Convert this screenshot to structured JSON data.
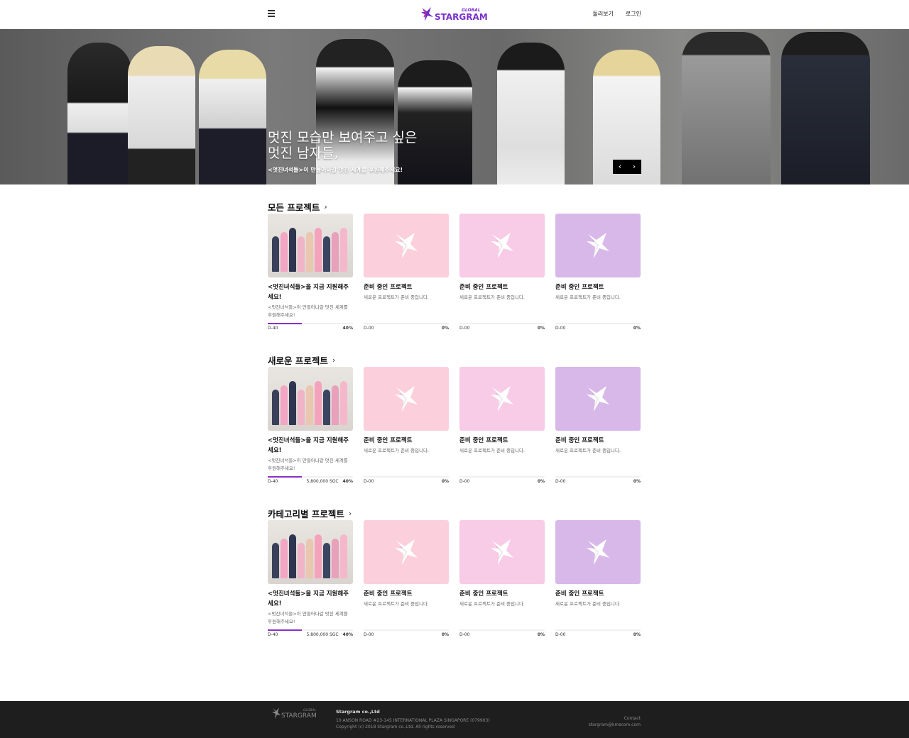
{
  "header": {
    "logo_small": "GLOBAL",
    "logo_main": "STARGRAM",
    "nav": [
      "둘러보기",
      "로그인"
    ]
  },
  "hero": {
    "title_line1": "멋진 모습만 보여주고 싶은",
    "title_line2": "멋진 남자들,",
    "subtitle": "<멋진녀석들>이 만들어나갈 멋진 세계를 후원해주세요!",
    "prev": "‹",
    "next": "›"
  },
  "sections": [
    {
      "title": "모든 프로젝트",
      "cards": [
        {
          "type": "photo",
          "title": "<멋진녀석들>을 지금 지원해주세요!",
          "desc": "<멋진녀석들>이 만들어나갈 멋진 세계를 후원해주세요!",
          "dday": "D-40",
          "amount": "",
          "percent": "40%",
          "progress": 0.4
        },
        {
          "type": "placeholder",
          "color": "#fccfdc",
          "title": "준비 중인 프로젝트",
          "desc": "새로운 프로젝트가 준비 중입니다.",
          "dday": "D-00",
          "amount": "",
          "percent": "0%",
          "progress": 0
        },
        {
          "type": "placeholder",
          "color": "#f8cbe6",
          "title": "준비 중인 프로젝트",
          "desc": "새로운 프로젝트가 준비 중입니다.",
          "dday": "D-00",
          "amount": "",
          "percent": "0%",
          "progress": 0
        },
        {
          "type": "placeholder",
          "color": "#d8b8e8",
          "title": "준비 중인 프로젝트",
          "desc": "새로운 프로젝트가 준비 중입니다.",
          "dday": "D-00",
          "amount": "",
          "percent": "0%",
          "progress": 0
        }
      ]
    },
    {
      "title": "새로운 프로젝트",
      "cards": [
        {
          "type": "photo",
          "title": "<멋진녀석들>을 지금 지원해주세요!",
          "desc": "<멋진녀석들>이 만들어나갈 멋진 세계를 후원해주세요!",
          "dday": "D-40",
          "amount": "5,800,000 SGC",
          "percent": "40%",
          "progress": 0.4
        },
        {
          "type": "placeholder",
          "color": "#fccfdc",
          "title": "준비 중인 프로젝트",
          "desc": "새로운 프로젝트가 준비 중입니다.",
          "dday": "D-00",
          "amount": "",
          "percent": "0%",
          "progress": 0
        },
        {
          "type": "placeholder",
          "color": "#f8cbe6",
          "title": "준비 중인 프로젝트",
          "desc": "새로운 프로젝트가 준비 중입니다.",
          "dday": "D-00",
          "amount": "",
          "percent": "0%",
          "progress": 0
        },
        {
          "type": "placeholder",
          "color": "#d8b8e8",
          "title": "준비 중인 프로젝트",
          "desc": "새로운 프로젝트가 준비 중입니다.",
          "dday": "D-00",
          "amount": "",
          "percent": "0%",
          "progress": 0
        }
      ]
    },
    {
      "title": "카테고리별 프로젝트",
      "cards": [
        {
          "type": "photo",
          "title": "<멋진녀석들>을 지금 지원해주세요!",
          "desc": "<멋진녀석들>이 만들어나갈 멋진 세계를 후원해주세요!",
          "dday": "D-40",
          "amount": "5,800,000 SGC",
          "percent": "40%",
          "progress": 0.4
        },
        {
          "type": "placeholder",
          "color": "#fccfdc",
          "title": "준비 중인 프로젝트",
          "desc": "새로운 프로젝트가 준비 중입니다.",
          "dday": "D-00",
          "amount": "",
          "percent": "0%",
          "progress": 0
        },
        {
          "type": "placeholder",
          "color": "#f8cbe6",
          "title": "준비 중인 프로젝트",
          "desc": "새로운 프로젝트가 준비 중입니다.",
          "dday": "D-00",
          "amount": "",
          "percent": "0%",
          "progress": 0
        },
        {
          "type": "placeholder",
          "color": "#d8b8e8",
          "title": "준비 중인 프로젝트",
          "desc": "새로운 프로젝트가 준비 중입니다.",
          "dday": "D-00",
          "amount": "",
          "percent": "0%",
          "progress": 0
        }
      ]
    }
  ],
  "footer": {
    "company": "Stargram co.,Ltd",
    "address": "10 ANSON ROAD #23-145 INTERNATIONAL PLAZA SINGAPORE (079903)",
    "copyright": "Copyright (c) 2018 Stargram co.,Ltd. All rights reserved",
    "contact_label": "Contact",
    "contact_email": "stargram@kmscom.com"
  },
  "colors": {
    "brand": "#8b2fc9",
    "footer_bg": "#1e1e1e"
  }
}
